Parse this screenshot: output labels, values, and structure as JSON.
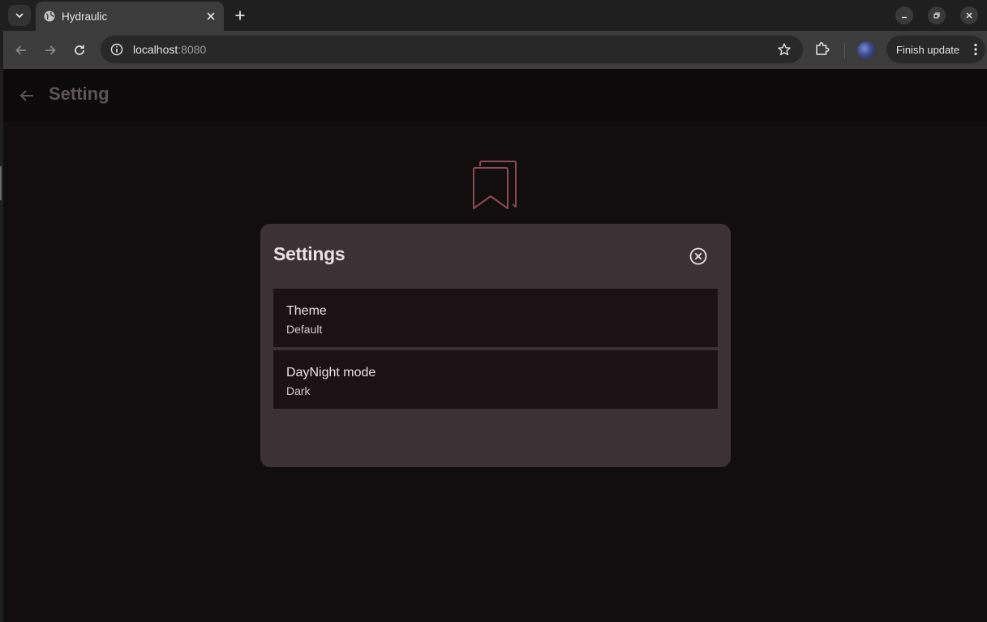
{
  "browser": {
    "tab_title": "Hydraulic",
    "url_host": "localhost",
    "url_port": ":8080",
    "finish_update_label": "Finish update"
  },
  "appbar": {
    "title": "Setting"
  },
  "dialog": {
    "title": "Settings",
    "items": [
      {
        "label": "Theme",
        "value": "Default"
      },
      {
        "label": "DayNight mode",
        "value": "Dark"
      }
    ]
  },
  "colors": {
    "page_bg": "#120e0f",
    "dialog_bg": "#3c3235",
    "item_bg": "#1c1215",
    "accent_outline": "#8a4a56"
  },
  "icons": {
    "tab_search": "chevron-down-icon",
    "favicon": "globe-icon",
    "tab_close": "close-icon",
    "new_tab": "plus-icon",
    "back": "arrow-left-icon",
    "forward": "arrow-right-icon",
    "reload": "reload-icon",
    "site_info": "info-icon",
    "bookmark_star": "star-icon",
    "extensions": "puzzle-icon",
    "menu": "more-vertical-icon",
    "dialog_close": "close-circle-icon",
    "empty_state": "bookmark-stack-icon"
  }
}
